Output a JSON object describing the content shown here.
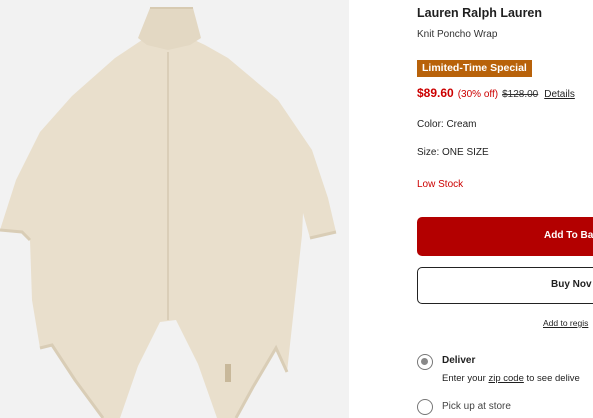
{
  "product": {
    "brand": "Lauren Ralph Lauren",
    "name": "Knit Poncho Wrap",
    "image_alt": "Cream knit poncho wrap"
  },
  "promo": {
    "badge": "Limited-Time Special"
  },
  "price": {
    "sale": "$89.60",
    "discount": "(30% off)",
    "original": "$128.00",
    "details_link": "Details"
  },
  "attributes": {
    "color": "Color: Cream",
    "size": "Size: ONE SIZE",
    "stock": "Low Stock"
  },
  "actions": {
    "add_to_bag": "Add To Ba",
    "buy_now": "Buy Nov",
    "registry": "Add to regis"
  },
  "fulfillment": {
    "deliver_label": "Deliver",
    "enter_your": "Enter your",
    "zip_code": "zip code",
    "to_see": "to see delive",
    "pickup_label": "Pick up at store"
  },
  "colors": {
    "promo_bg": "#b8620a",
    "sale_red": "#cc0000",
    "add_button": "#b30000",
    "poncho": "#e9dfcc"
  }
}
